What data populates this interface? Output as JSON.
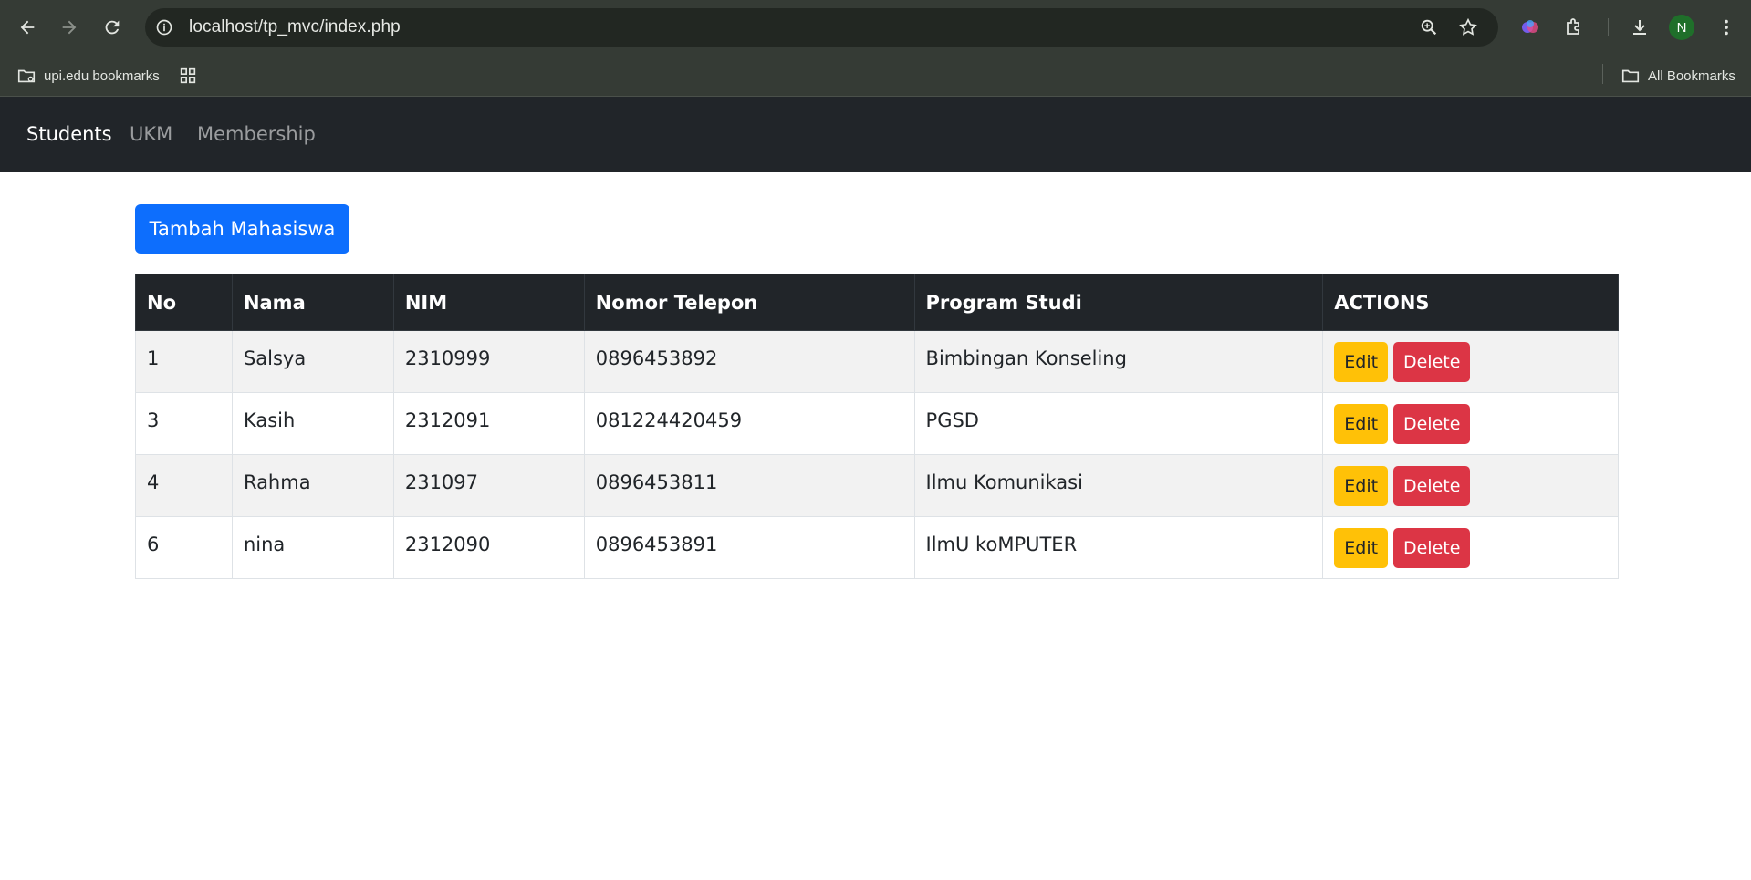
{
  "browser": {
    "url": "localhost/tp_mvc/index.php",
    "profile_initial": "N",
    "bookmarks": [
      {
        "label": "upi.edu bookmarks",
        "icon": "folder-managed-icon"
      },
      {
        "label": "",
        "icon": "apps-grid-icon"
      }
    ],
    "all_bookmarks_label": "All Bookmarks"
  },
  "navbar": {
    "links": [
      {
        "label": "Students",
        "active": true
      },
      {
        "label": "UKM",
        "active": false
      },
      {
        "label": "Membership",
        "active": false
      }
    ]
  },
  "main": {
    "add_button_label": "Tambah Mahasiswa",
    "table": {
      "headers": [
        "No",
        "Nama",
        "NIM",
        "Nomor Telepon",
        "Program Studi",
        "ACTIONS"
      ],
      "rows": [
        {
          "no": "1",
          "nama": "Salsya",
          "nim": "2310999",
          "telepon": "0896453892",
          "prodi": "Bimbingan Konseling"
        },
        {
          "no": "3",
          "nama": "Kasih",
          "nim": "2312091",
          "telepon": "081224420459",
          "prodi": "PGSD"
        },
        {
          "no": "4",
          "nama": "Rahma",
          "nim": "231097",
          "telepon": "0896453811",
          "prodi": "Ilmu Komunikasi"
        },
        {
          "no": "6",
          "nama": "nina",
          "nim": "2312090",
          "telepon": "0896453891",
          "prodi": "IlmU koMPUTER"
        }
      ],
      "edit_label": "Edit",
      "delete_label": "Delete"
    }
  },
  "colors": {
    "primary": "#0d6efd",
    "warning": "#ffc107",
    "danger": "#dc3545",
    "dark": "#212529"
  }
}
